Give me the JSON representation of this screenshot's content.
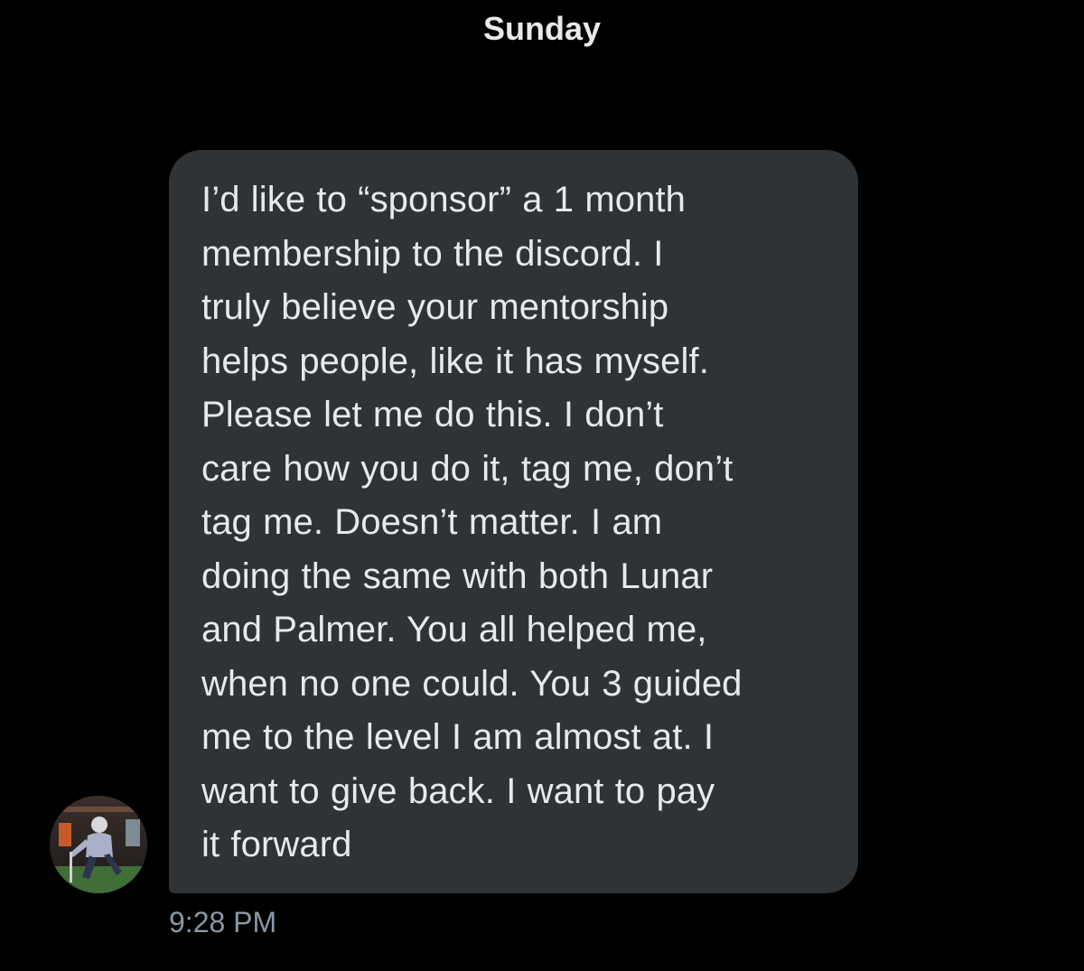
{
  "header": {
    "day_label": "Sunday"
  },
  "message": {
    "lines": [
      "I’d like to “sponsor” a 1 month",
      "membership to the discord. I",
      "truly believe your mentorship",
      "helps people, like it has myself.",
      "Please let me do this. I don’t",
      "care how you do it, tag me, don’t",
      "tag me. Doesn’t matter. I am",
      "doing the same with both Lunar",
      "and Palmer. You all helped me,",
      "when no one could. You 3 guided",
      "me to the level I am almost at. I",
      "want to give back. I want to pay",
      "it forward"
    ],
    "timestamp": "9:28 PM"
  },
  "sender": {
    "avatar_icon": "user-avatar-photo"
  },
  "colors": {
    "background": "#000000",
    "bubble": "#2f3336",
    "text": "#e7e9ea",
    "timestamp": "#8b98a5"
  }
}
